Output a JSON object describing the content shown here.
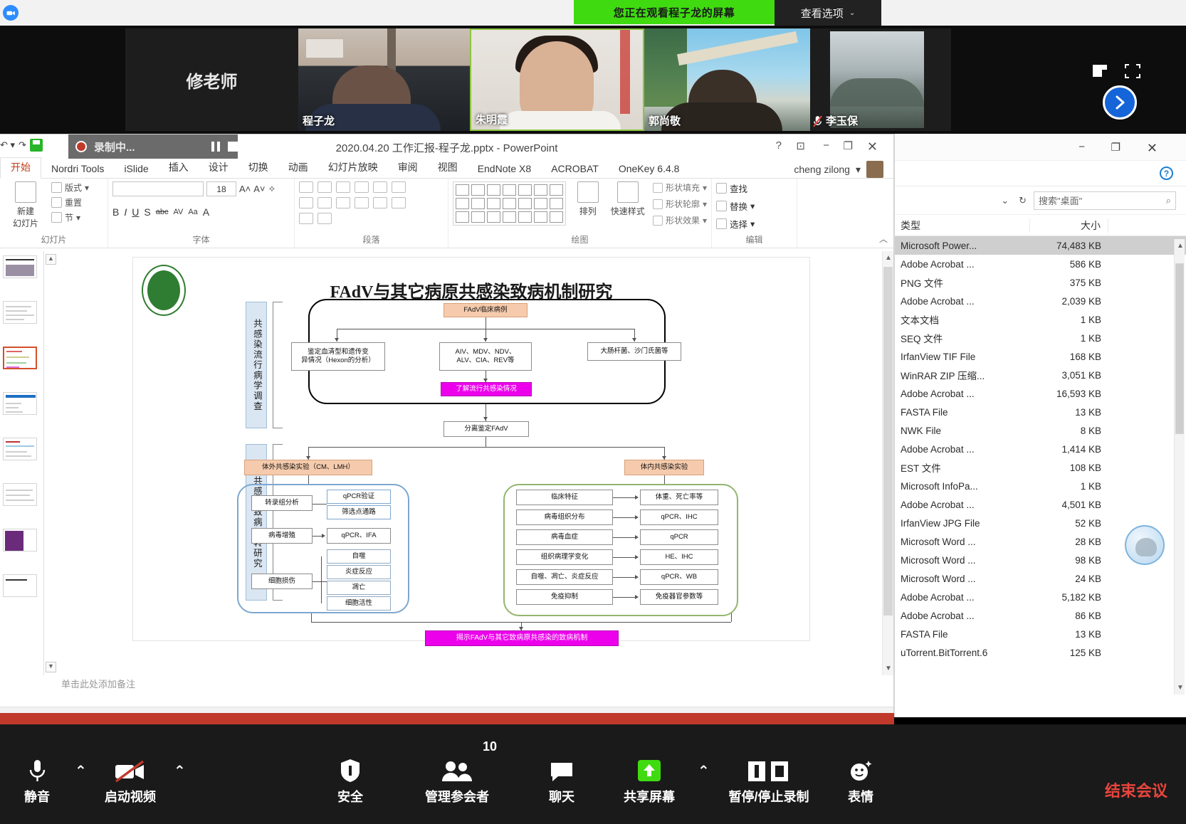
{
  "zoom_top": {
    "share_banner": "您正在观看程子龙的屏幕",
    "view_options": "查看选项",
    "chevron": "⌄",
    "host_label": "修老师",
    "participants": [
      {
        "name": "程子龙",
        "muted": false
      },
      {
        "name": "朱明霞",
        "muted": false
      },
      {
        "name": "郭尚敬",
        "muted": false
      },
      {
        "name": "李玉保",
        "muted": true
      }
    ]
  },
  "powerpoint": {
    "title": "2020.04.20 工作汇报-程子龙.pptx - PowerPoint",
    "recording_label": "录制中...",
    "account": "cheng zilong",
    "window_controls": {
      "help": "?",
      "ribbon": "⊡",
      "minimize": "−",
      "maximize": "❐",
      "close": "✕"
    },
    "tabs": [
      {
        "label": "开始",
        "active": true
      },
      {
        "label": "Nordri Tools",
        "active": false
      },
      {
        "label": "iSlide",
        "active": false
      },
      {
        "label": "插入",
        "active": false
      },
      {
        "label": "设计",
        "active": false
      },
      {
        "label": "切换",
        "active": false
      },
      {
        "label": "动画",
        "active": false
      },
      {
        "label": "幻灯片放映",
        "active": false
      },
      {
        "label": "审阅",
        "active": false
      },
      {
        "label": "视图",
        "active": false
      },
      {
        "label": "EndNote X8",
        "active": false
      },
      {
        "label": "ACROBAT",
        "active": false
      },
      {
        "label": "OneKey 6.4.8",
        "active": false
      }
    ],
    "ribbon_groups": [
      {
        "label": "幻灯片"
      },
      {
        "label": "字体"
      },
      {
        "label": "段落"
      },
      {
        "label": "绘图"
      },
      {
        "label": "编辑"
      }
    ],
    "slides_group": {
      "new_slide": "新建\n幻灯片",
      "layout": "版式",
      "reset": "重置",
      "section": "节"
    },
    "font_group": {
      "font_name": "",
      "font_size": "18",
      "bold": "B",
      "italic": "I",
      "underline": "U",
      "strike": "S",
      "shadow": "abc",
      "char_spacing": "AV",
      "case": "Aa",
      "color": "A"
    },
    "drawing_group": {
      "arrange": "排列",
      "quick_styles": "快速样式",
      "shape_fill": "形状填充",
      "shape_outline": "形状轮廓",
      "shape_effects": "形状效果"
    },
    "editing_group": {
      "find": "查找",
      "replace": "替换",
      "select": "选择"
    },
    "notes_placeholder": "单击此处添加备注"
  },
  "slide": {
    "title": "FAdV与其它病原共感染致病机制研究",
    "title_underline": "FAdV",
    "side_tabs": [
      "共感染流行病学调查",
      "共感染致病机转研究"
    ],
    "epi_section": {
      "root": "FAdV临床病例",
      "branches": [
        "鉴定血清型和遗传变\n异情况（Hexon的分析）",
        "AIV、MDV、NDV、\nALV、CIA、REV等",
        "大肠杆菌、沙门氏菌等"
      ],
      "result": "了解流行共感染情况"
    },
    "isolate": "分离鉴定FAdV",
    "invitro_header": "体外共感染实验（CM、LMH）",
    "invivo_header": "体内共感染实验",
    "invitro_rows": [
      {
        "left": "转录组分析",
        "right": [
          "qPCR验证",
          "筛选点通路"
        ]
      },
      {
        "left": "病毒增殖",
        "right": [
          "qPCR、IFA"
        ]
      },
      {
        "left": "细胞损伤",
        "right": [
          "自噬",
          "炎症反应",
          "凋亡",
          "细胞活性"
        ]
      }
    ],
    "invivo_rows": [
      {
        "left": "临床特征",
        "right": "体重、死亡率等"
      },
      {
        "left": "病毒组织分布",
        "right": "qPCR、IHC"
      },
      {
        "left": "病毒血症",
        "right": "qPCR"
      },
      {
        "left": "组织病理学变化",
        "right": "HE、IHC"
      },
      {
        "left": "自噬、凋亡、炎症反应",
        "right": "qPCR、WB"
      },
      {
        "left": "免疫抑制",
        "right": "免疫器官参数等"
      }
    ],
    "conclusion": "揭示FAdV与其它致病原共感染的致病机制"
  },
  "explorer": {
    "search_placeholder": "搜索\"桌面\"",
    "refresh_icon": "↻",
    "dropdown_icon": "⌄",
    "search_icon": "⌕",
    "columns": [
      "类型",
      "大小"
    ],
    "files": [
      {
        "type": "Microsoft Power...",
        "size": "74,483 KB",
        "selected": true
      },
      {
        "type": "Adobe Acrobat ...",
        "size": "586 KB",
        "selected": false
      },
      {
        "type": "PNG 文件",
        "size": "375 KB",
        "selected": false
      },
      {
        "type": "Adobe Acrobat ...",
        "size": "2,039 KB",
        "selected": false
      },
      {
        "type": "文本文档",
        "size": "1 KB",
        "selected": false
      },
      {
        "type": "SEQ 文件",
        "size": "1 KB",
        "selected": false
      },
      {
        "type": "IrfanView TIF File",
        "size": "168 KB",
        "selected": false
      },
      {
        "type": "WinRAR ZIP 压缩...",
        "size": "3,051 KB",
        "selected": false
      },
      {
        "type": "Adobe Acrobat ...",
        "size": "16,593 KB",
        "selected": false
      },
      {
        "type": "FASTA File",
        "size": "13 KB",
        "selected": false
      },
      {
        "type": "NWK File",
        "size": "8 KB",
        "selected": false
      },
      {
        "type": "Adobe Acrobat ...",
        "size": "1,414 KB",
        "selected": false
      },
      {
        "type": "EST 文件",
        "size": "108 KB",
        "selected": false
      },
      {
        "type": "Microsoft InfoPa...",
        "size": "1 KB",
        "selected": false
      },
      {
        "type": "Adobe Acrobat ...",
        "size": "4,501 KB",
        "selected": false
      },
      {
        "type": "IrfanView JPG File",
        "size": "52 KB",
        "selected": false
      },
      {
        "type": "Microsoft Word ...",
        "size": "28 KB",
        "selected": false
      },
      {
        "type": "Microsoft Word ...",
        "size": "98 KB",
        "selected": false
      },
      {
        "type": "Microsoft Word ...",
        "size": "24 KB",
        "selected": false
      },
      {
        "type": "Adobe Acrobat ...",
        "size": "5,182 KB",
        "selected": false
      },
      {
        "type": "Adobe Acrobat ...",
        "size": "86 KB",
        "selected": false
      },
      {
        "type": "FASTA File",
        "size": "13 KB",
        "selected": false
      },
      {
        "type": "uTorrent.BitTorrent.6",
        "size": "125 KB",
        "selected": false
      }
    ],
    "window_controls": {
      "minimize": "−",
      "maximize": "❐",
      "close": "✕",
      "help": "?"
    }
  },
  "zoom_bottom": {
    "mute": "静音",
    "start_video": "启动视频",
    "security": "安全",
    "manage_participants": "管理参会者",
    "participant_count": "10",
    "chat": "聊天",
    "share_screen": "共享屏幕",
    "pause_stop_record": "暂停/停止录制",
    "reactions": "表情",
    "end_meeting": "结束会议",
    "caret": "⌃"
  },
  "colors": {
    "share_green": "#3fdb10",
    "zoom_blue": "#2d8cff",
    "end_red": "#e8453c",
    "ppt_orange": "#c43e1c",
    "record_red": "#c0392b",
    "slide_magenta": "#ec00ec",
    "slide_peach": "#f6cbad"
  }
}
